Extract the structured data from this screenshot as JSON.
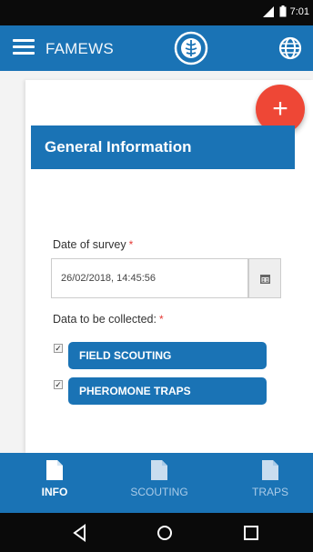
{
  "status_bar": {
    "time": "7:01"
  },
  "app_bar": {
    "title": "FAMEWS"
  },
  "fab": {
    "label": "+"
  },
  "section": {
    "title": "General Information"
  },
  "form": {
    "date_label": "Date of survey",
    "required_mark": "*",
    "date_value": "26/02/2018, 14:45:56",
    "collect_label": "Data to be collected:",
    "options": [
      {
        "label": "FIELD SCOUTING",
        "checked": true
      },
      {
        "label": "PHEROMONE TRAPS",
        "checked": true
      }
    ]
  },
  "bottom_nav": {
    "items": [
      {
        "label": "INFO",
        "active": true
      },
      {
        "label": "SCOUTING",
        "active": false
      },
      {
        "label": "TRAPS",
        "active": false
      }
    ]
  },
  "colors": {
    "primary": "#1a73b5",
    "accent": "#ee4736",
    "required": "#e53935"
  },
  "icons": [
    "menu-icon",
    "fao-logo-icon",
    "globe-icon",
    "calendar-icon",
    "document-icon",
    "back-icon",
    "home-icon",
    "recents-icon"
  ]
}
